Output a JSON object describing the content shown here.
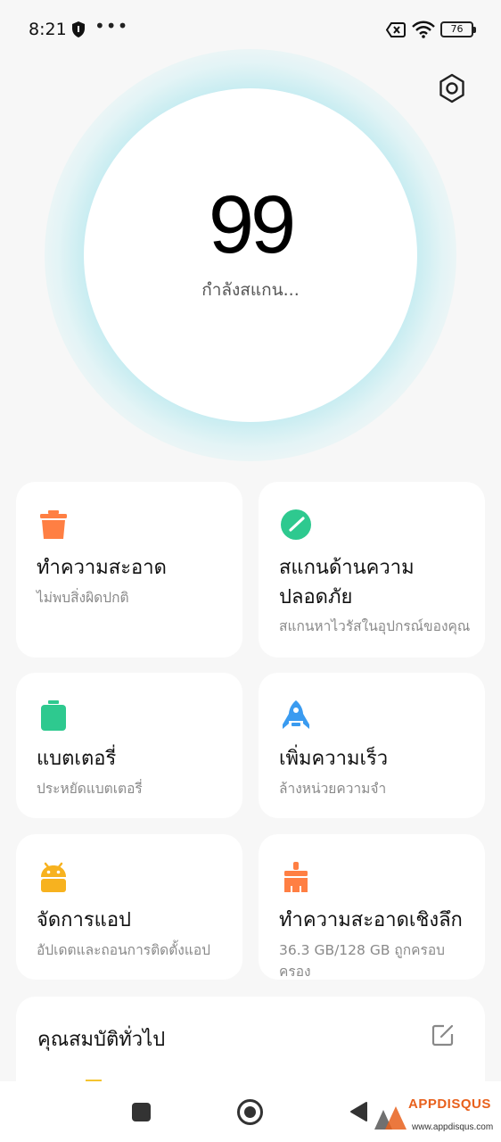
{
  "status_bar": {
    "time": "8:21",
    "more": "•••",
    "battery": "76"
  },
  "score": {
    "value": "99",
    "status": "กำลังสแกน..."
  },
  "cards": [
    {
      "title": "ทำความสะอาด",
      "subtitle": "ไม่พบสิ่งผิดปกติ",
      "icon": "trash-bin-icon",
      "color": "#ff7f43"
    },
    {
      "title": "สแกนด้านความปลอดภัย",
      "subtitle": "สแกนหาไวรัสในอุปกรณ์ของคุณ",
      "icon": "security-scan-icon",
      "color": "#2ec98f"
    },
    {
      "title": "แบตเตอรี่",
      "subtitle": "ประหยัดแบตเตอรี่",
      "icon": "battery-icon",
      "color": "#2ec98f"
    },
    {
      "title": "เพิ่มความเร็ว",
      "subtitle": "ล้างหน่วยความจำ",
      "icon": "rocket-icon",
      "color": "#3a9bf0"
    },
    {
      "title": "จัดการแอป",
      "subtitle": "อัปเดตและถอนการติดตั้งแอป",
      "icon": "android-icon",
      "color": "#f7b21f"
    },
    {
      "title": "ทำความสะอาดเชิงลึก",
      "subtitle": "36.3 GB/128 GB ถูกครอบครอง",
      "icon": "brush-icon",
      "color": "#ff7f43"
    }
  ],
  "general": {
    "title": "คุณสมบัติทั่วไป",
    "accent": "#f4c430"
  },
  "watermark": {
    "brand": "APPDISQUS",
    "url": "www.appdisqus.com"
  },
  "colors": {
    "glow": "#9fe3ec",
    "background": "#f7f7f7"
  }
}
